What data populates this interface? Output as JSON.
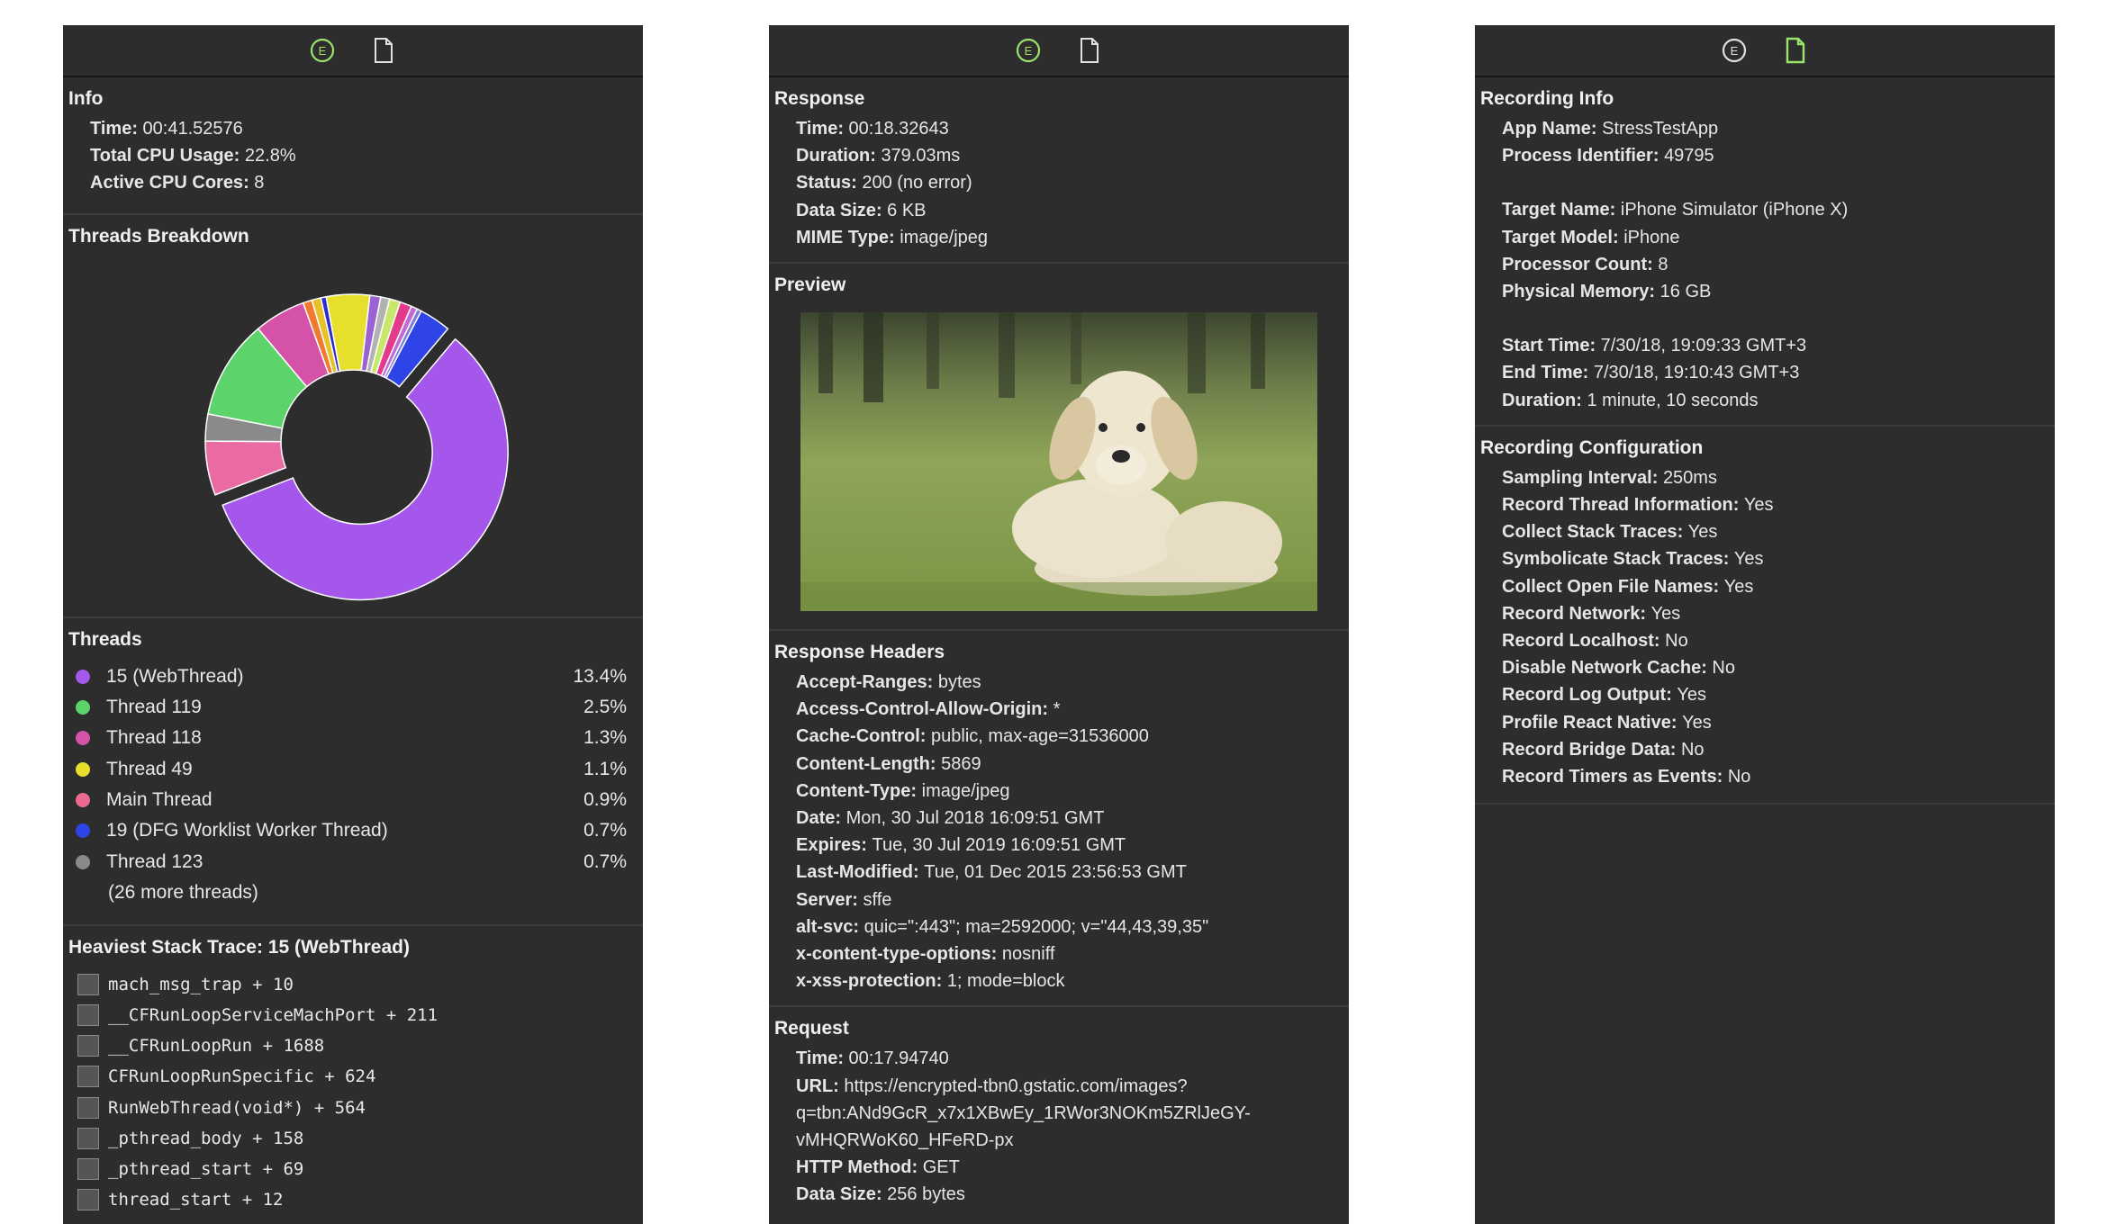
{
  "icons": {
    "e_icon": "e-circle-icon",
    "doc_icon": "document-icon"
  },
  "colors": {
    "panel_bg": "#2d2d2d",
    "accent_green": "#9be36a"
  },
  "panel1": {
    "info": {
      "title": "Info",
      "rows": [
        {
          "k": "Time",
          "v": "00:41.52576"
        },
        {
          "k": "Total CPU Usage",
          "v": "22.8%"
        },
        {
          "k": "Active CPU Cores",
          "v": "8"
        }
      ]
    },
    "breakdown": {
      "title": "Threads Breakdown",
      "slices": [
        {
          "value": 58.8,
          "color": "#a457ea"
        },
        {
          "value": 6.0,
          "color": "#ea6ba4"
        },
        {
          "value": 3.0,
          "color": "#8a8a8a"
        },
        {
          "value": 11.0,
          "color": "#5dd46b"
        },
        {
          "value": 5.7,
          "color": "#d453a8"
        },
        {
          "value": 1.0,
          "color": "#f07a2f"
        },
        {
          "value": 1.0,
          "color": "#e6c22a"
        },
        {
          "value": 0.6,
          "color": "#2c2ccf"
        },
        {
          "value": 4.8,
          "color": "#e6e02c"
        },
        {
          "value": 1.2,
          "color": "#9b62d4"
        },
        {
          "value": 1.0,
          "color": "#b2b2b2"
        },
        {
          "value": 1.2,
          "color": "#c7e86a"
        },
        {
          "value": 1.3,
          "color": "#e33b8b"
        },
        {
          "value": 0.7,
          "color": "#c06ad8"
        },
        {
          "value": 0.5,
          "color": "#7b7bd8"
        },
        {
          "value": 3.5,
          "color": "#2f44e6"
        }
      ]
    },
    "threads": {
      "title": "Threads",
      "items": [
        {
          "name": "15 (WebThread)",
          "pct": "13.4%",
          "color": "#a457ea"
        },
        {
          "name": "Thread 119",
          "pct": "2.5%",
          "color": "#5dd46b"
        },
        {
          "name": "Thread 118",
          "pct": "1.3%",
          "color": "#d453a8"
        },
        {
          "name": "Thread 49",
          "pct": "1.1%",
          "color": "#e6e02c"
        },
        {
          "name": "Main Thread",
          "pct": "0.9%",
          "color": "#ea6b8f"
        },
        {
          "name": "19 (DFG Worklist Worker Thread)",
          "pct": "0.7%",
          "color": "#2f44e6"
        },
        {
          "name": "Thread 123",
          "pct": "0.7%",
          "color": "#8a8a8a"
        }
      ],
      "more": "(26 more threads)"
    },
    "stack": {
      "title": "Heaviest Stack Trace: 15 (WebThread)",
      "frames": [
        {
          "text": "mach_msg_trap + 10",
          "icon": "gear-icon"
        },
        {
          "text": "__CFRunLoopServiceMachPort + 211",
          "icon": "function-list-icon"
        },
        {
          "text": "__CFRunLoopRun + 1688",
          "icon": "function-list-icon"
        },
        {
          "text": "CFRunLoopRunSpecific + 624",
          "icon": "function-list-icon"
        },
        {
          "text": "RunWebThread(void*) + 564",
          "icon": "hammer-icon"
        },
        {
          "text": "_pthread_body + 158",
          "icon": "gear-icon"
        },
        {
          "text": "_pthread_start + 69",
          "icon": "gear-icon"
        },
        {
          "text": "thread_start + 12",
          "icon": "gear-icon"
        }
      ]
    }
  },
  "panel2": {
    "response": {
      "title": "Response",
      "rows": [
        {
          "k": "Time",
          "v": "00:18.32643"
        },
        {
          "k": "Duration",
          "v": "379.03ms"
        },
        {
          "k": "Status",
          "v": "200 (no error)"
        },
        {
          "k": "Data Size",
          "v": "6 KB"
        },
        {
          "k": "MIME Type",
          "v": "image/jpeg"
        }
      ]
    },
    "preview": {
      "title": "Preview"
    },
    "headers": {
      "title": "Response Headers",
      "rows": [
        {
          "k": "Accept-Ranges",
          "v": "bytes"
        },
        {
          "k": "Access-Control-Allow-Origin",
          "v": "*"
        },
        {
          "k": "Cache-Control",
          "v": "public, max-age=31536000"
        },
        {
          "k": "Content-Length",
          "v": "5869"
        },
        {
          "k": "Content-Type",
          "v": "image/jpeg"
        },
        {
          "k": "Date",
          "v": "Mon, 30 Jul 2018 16:09:51 GMT"
        },
        {
          "k": "Expires",
          "v": "Tue, 30 Jul 2019 16:09:51 GMT"
        },
        {
          "k": "Last-Modified",
          "v": "Tue, 01 Dec 2015 23:56:53 GMT"
        },
        {
          "k": "Server",
          "v": "sffe"
        },
        {
          "k": "alt-svc",
          "v": "quic=\":443\"; ma=2592000; v=\"44,43,39,35\""
        },
        {
          "k": "x-content-type-options",
          "v": "nosniff"
        },
        {
          "k": "x-xss-protection",
          "v": "1; mode=block"
        }
      ]
    },
    "request": {
      "title": "Request",
      "time_k": "Time",
      "time_v": "00:17.94740",
      "url_k": "URL",
      "url_v1": "https://encrypted-tbn0.gstatic.com/images?",
      "url_v2": "q=tbn:ANd9GcR_x7x1XBwEy_1RWor3NOKm5ZRlJeGY-",
      "url_v3": "vMHQRWoK60_HFeRD-px",
      "method_k": "HTTP Method",
      "method_v": "GET",
      "size_k": "Data Size",
      "size_v": "256 bytes"
    }
  },
  "panel3": {
    "recording": {
      "title": "Recording Info",
      "group1": [
        {
          "k": "App Name",
          "v": "StressTestApp"
        },
        {
          "k": "Process Identifier",
          "v": "49795"
        }
      ],
      "group2": [
        {
          "k": "Target Name",
          "v": "iPhone Simulator (iPhone X)"
        },
        {
          "k": "Target Model",
          "v": "iPhone"
        },
        {
          "k": "Processor Count",
          "v": "8"
        },
        {
          "k": "Physical Memory",
          "v": "16 GB"
        }
      ],
      "group3": [
        {
          "k": "Start Time",
          "v": "7/30/18, 19:09:33 GMT+3"
        },
        {
          "k": "End Time",
          "v": "7/30/18, 19:10:43 GMT+3"
        },
        {
          "k": "Duration",
          "v": "1 minute, 10 seconds"
        }
      ]
    },
    "config": {
      "title": "Recording Configuration",
      "rows": [
        {
          "k": "Sampling Interval",
          "v": "250ms"
        },
        {
          "k": "Record Thread Information",
          "v": "Yes"
        },
        {
          "k": "Collect Stack Traces",
          "v": "Yes"
        },
        {
          "k": "Symbolicate Stack Traces",
          "v": "Yes"
        },
        {
          "k": "Collect Open File Names",
          "v": "Yes"
        },
        {
          "k": "Record Network",
          "v": "Yes"
        },
        {
          "k": "Record Localhost",
          "v": "No"
        },
        {
          "k": "Disable Network Cache",
          "v": "No"
        },
        {
          "k": "Record Log Output",
          "v": "Yes"
        },
        {
          "k": "Profile React Native",
          "v": "Yes"
        },
        {
          "k": "Record Bridge Data",
          "v": "No"
        },
        {
          "k": "Record Timers as Events",
          "v": "No"
        }
      ]
    }
  }
}
